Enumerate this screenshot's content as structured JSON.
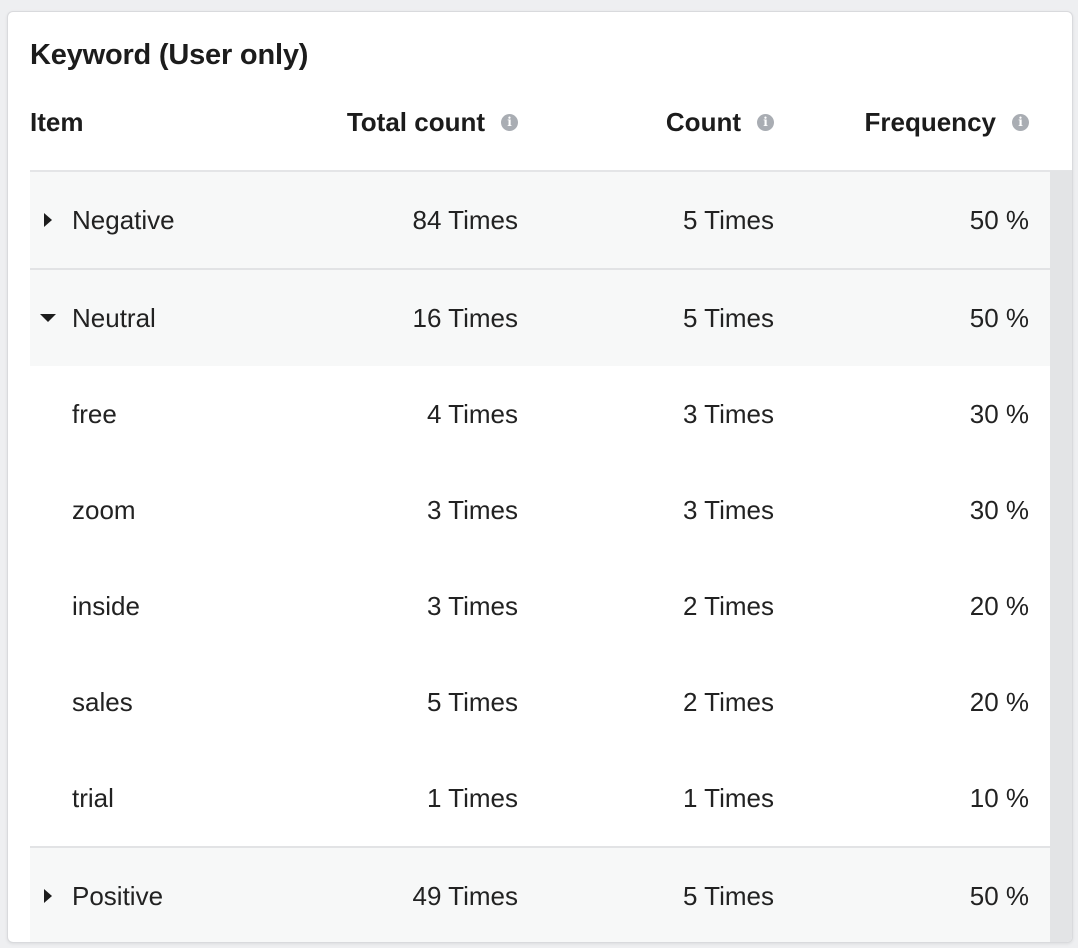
{
  "panel": {
    "title": "Keyword (User only)"
  },
  "columns": {
    "item": "Item",
    "total_count": "Total count",
    "count": "Count",
    "frequency": "Frequency"
  },
  "rows": [
    {
      "type": "group",
      "expanded": false,
      "item": "Negative",
      "total_count": "84 Times",
      "count": "5 Times",
      "frequency": "50 %"
    },
    {
      "type": "group",
      "expanded": true,
      "item": "Neutral",
      "total_count": "16 Times",
      "count": "5 Times",
      "frequency": "50 %"
    },
    {
      "type": "child",
      "item": "free",
      "total_count": "4 Times",
      "count": "3 Times",
      "frequency": "30 %"
    },
    {
      "type": "child",
      "item": "zoom",
      "total_count": "3 Times",
      "count": "3 Times",
      "frequency": "30 %"
    },
    {
      "type": "child",
      "item": "inside",
      "total_count": "3 Times",
      "count": "2 Times",
      "frequency": "20 %"
    },
    {
      "type": "child",
      "item": "sales",
      "total_count": "5 Times",
      "count": "2 Times",
      "frequency": "20 %"
    },
    {
      "type": "child",
      "item": "trial",
      "total_count": "1 Times",
      "count": "1 Times",
      "frequency": "10 %"
    },
    {
      "type": "group",
      "expanded": false,
      "item": "Positive",
      "total_count": "49 Times",
      "count": "5 Times",
      "frequency": "50 %"
    }
  ],
  "icons": {
    "info": "info-icon",
    "expand": "caret-right-icon",
    "collapse": "caret-down-icon"
  }
}
